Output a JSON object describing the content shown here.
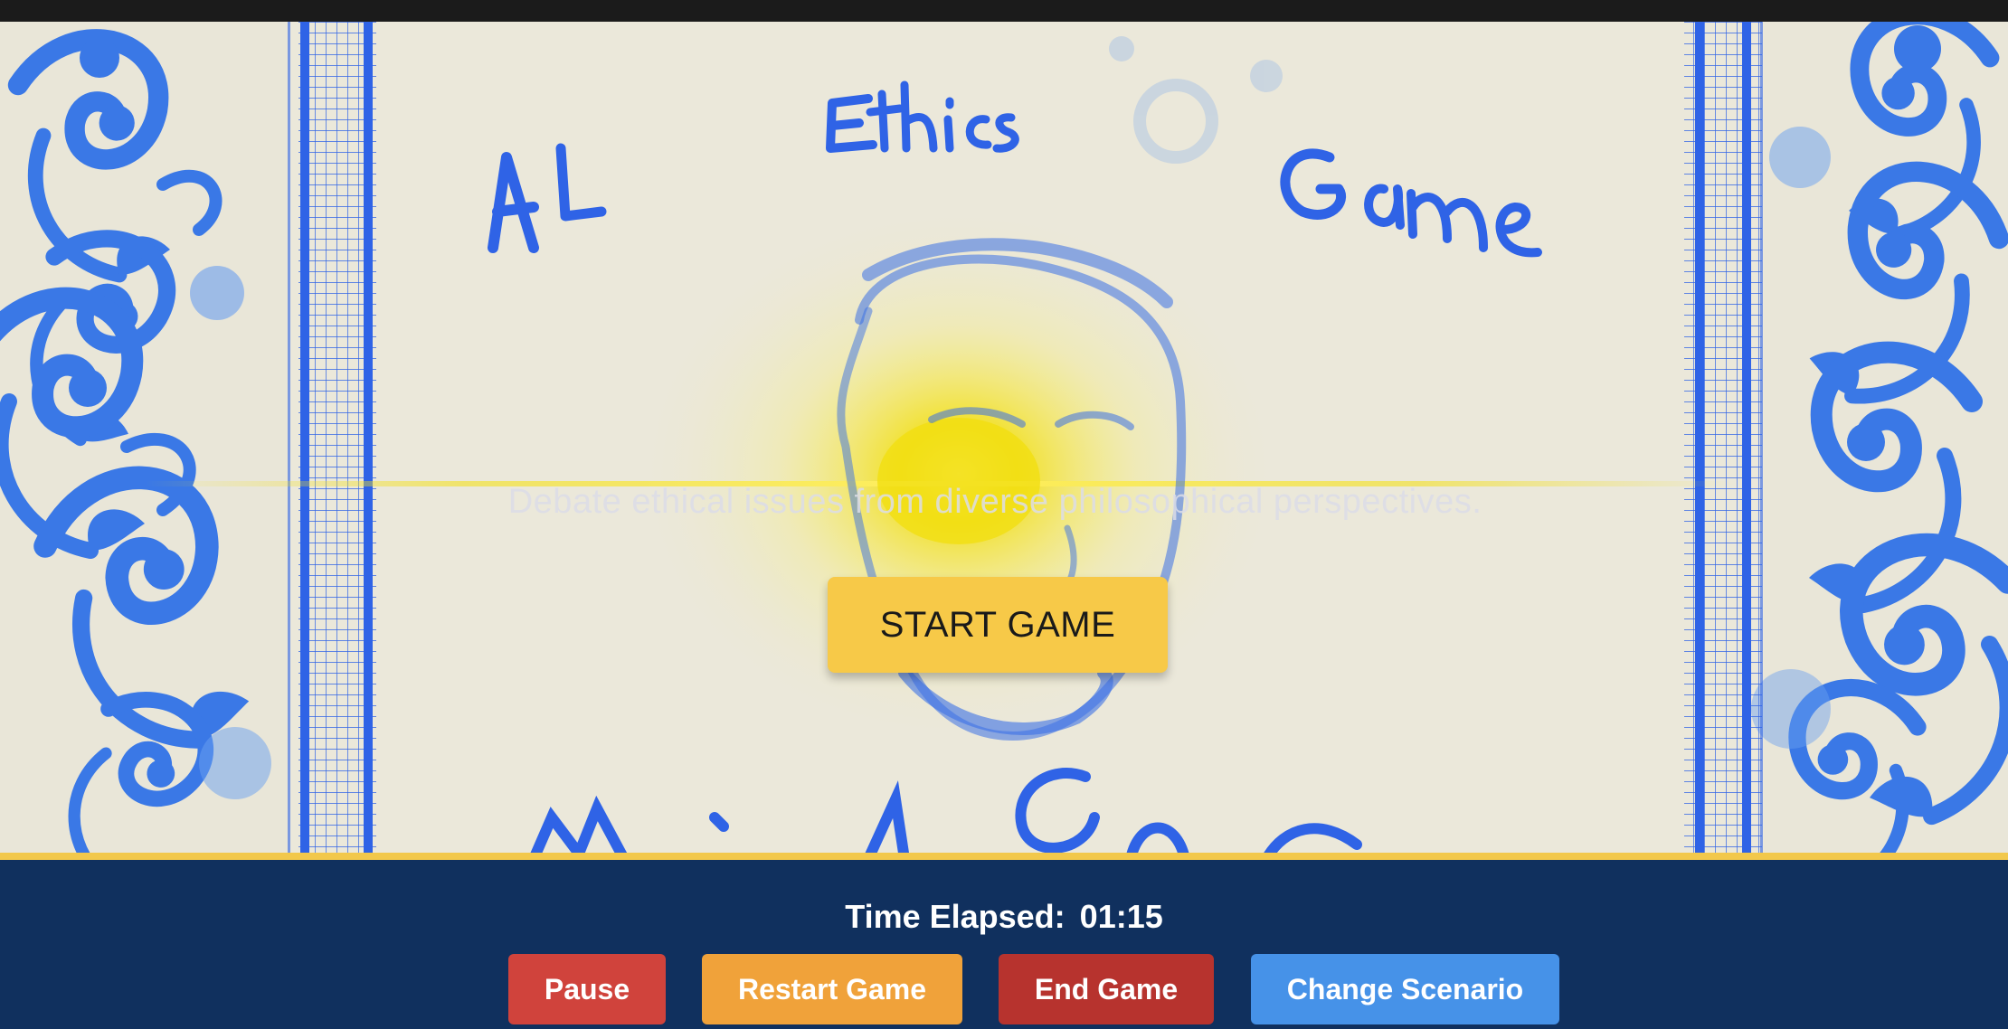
{
  "game": {
    "title_words": [
      "AI",
      "Ethics",
      "Game"
    ],
    "tagline": "Debate ethical issues from diverse philosophical perspectives.",
    "start_button": "START GAME"
  },
  "footer": {
    "timer_label": "Time Elapsed:",
    "timer_value": "01:15",
    "buttons": {
      "pause": "Pause",
      "restart": "Restart Game",
      "end": "End Game",
      "change_scenario": "Change Scenario"
    }
  },
  "colors": {
    "background": "#ebe8da",
    "ink": "#2f63e6",
    "start_button": "#f7c948",
    "footer_bg": "#10305e",
    "pause": "#d0433c",
    "restart": "#f0a23a",
    "end": "#b7332e",
    "change_scenario": "#4692e8"
  },
  "icons": [
    "blue-floral-ornament",
    "grid-column",
    "sketched-face",
    "yellow-glow"
  ]
}
